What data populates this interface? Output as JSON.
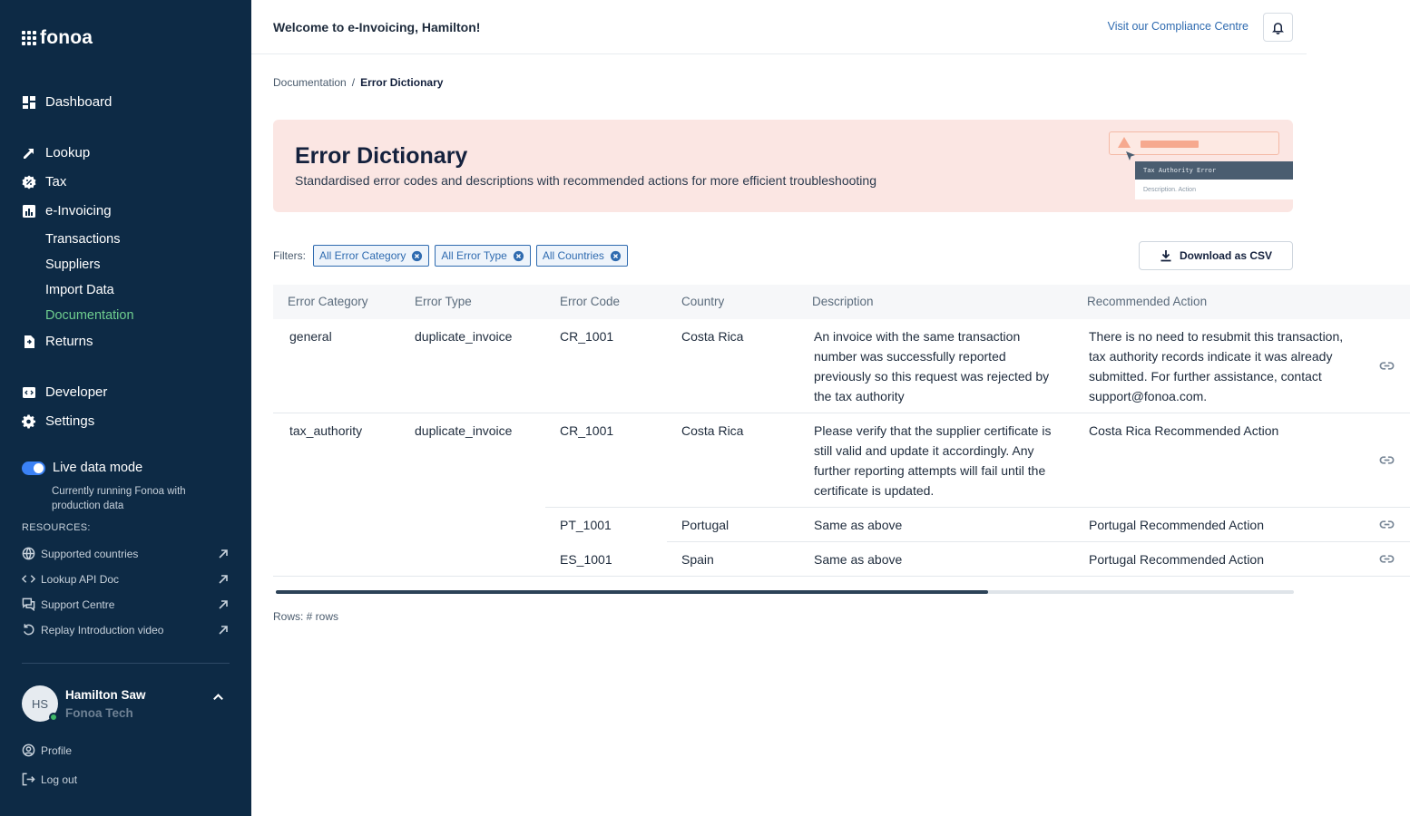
{
  "logo": {
    "text": "fonoa"
  },
  "sidebar": {
    "nav": [
      {
        "label": "Dashboard",
        "icon": "dashboard-icon"
      },
      {
        "label": "Lookup",
        "icon": "lookup-icon"
      },
      {
        "label": "Tax",
        "icon": "tax-icon"
      },
      {
        "label": "e-Invoicing",
        "icon": "einvoicing-icon"
      },
      {
        "label": "Returns",
        "icon": "returns-icon"
      },
      {
        "label": "Developer",
        "icon": "developer-icon"
      },
      {
        "label": "Settings",
        "icon": "gear-icon"
      }
    ],
    "sub": [
      {
        "label": "Transactions"
      },
      {
        "label": "Suppliers"
      },
      {
        "label": "Import Data"
      },
      {
        "label": "Documentation",
        "active": true
      }
    ],
    "live_mode": {
      "label": "Live data mode",
      "desc": "Currently running Fonoa with production data",
      "enabled": true
    },
    "resources_title": "RESOURCES:",
    "resources": [
      {
        "label": "Supported countries",
        "icon": "globe-icon"
      },
      {
        "label": "Lookup API Doc",
        "icon": "code-icon"
      },
      {
        "label": "Support Centre",
        "icon": "chat-icon"
      },
      {
        "label": "Replay Introduction video",
        "icon": "replay-icon"
      }
    ],
    "user": {
      "initials": "HS",
      "name": "Hamilton Saw",
      "org": "Fonoa Tech"
    },
    "profile_label": "Profile",
    "logout_label": "Log out"
  },
  "header": {
    "welcome": "Welcome to e-Invoicing, Hamilton!",
    "compliance_link": "Visit our Compliance Centre"
  },
  "breadcrumb": {
    "parent": "Documentation",
    "separator": "/",
    "current": "Error Dictionary"
  },
  "banner": {
    "title": "Error Dictionary",
    "subtitle": "Standardised error codes and descriptions with recommended actions for more efficient troubleshooting",
    "card_title": "Tax Authority Error",
    "card_sub": "Description. Action"
  },
  "filters": {
    "label": "Filters:",
    "chips": [
      "All Error Category",
      "All Error Type",
      "All Countries"
    ],
    "download_label": "Download as CSV"
  },
  "table": {
    "columns": [
      "Error Category",
      "Error Type",
      "Error Code",
      "Country",
      "Description",
      "Recommended Action"
    ],
    "groups": [
      {
        "category": "general",
        "type": "duplicate_invoice",
        "rows": [
          {
            "code": "CR_1001",
            "country": "Costa Rica",
            "description": "An invoice with the same transaction number was successfully reported previously so this request was rejected by the tax authority",
            "action": "There is no need to resubmit this transaction, tax authority records indicate it was already submitted. For further assistance, contact support@fonoa.com."
          }
        ]
      },
      {
        "category": "tax_authority",
        "type": "duplicate_invoice",
        "rows": [
          {
            "code": "CR_1001",
            "country": "Costa Rica",
            "description": "Please verify that the supplier certificate is still valid and update it accordingly. Any further reporting attempts will fail until the certificate is updated.",
            "action": "Costa Rica Recommended Action"
          },
          {
            "code": "PT_1001",
            "country": "Portugal",
            "description": "Same as above",
            "action": "Portugal Recommended Action"
          },
          {
            "code": "ES_1001",
            "country": "Spain",
            "description": "Same as above",
            "action": "Portugal Recommended Action"
          }
        ]
      }
    ],
    "rows_label": "Rows: # rows",
    "scroll_position": 0.7
  },
  "colors": {
    "sidebar": "#0d2a45",
    "accent_green": "#6fce8f",
    "link_blue": "#2f6bb0",
    "banner": "#fbe6e3"
  }
}
